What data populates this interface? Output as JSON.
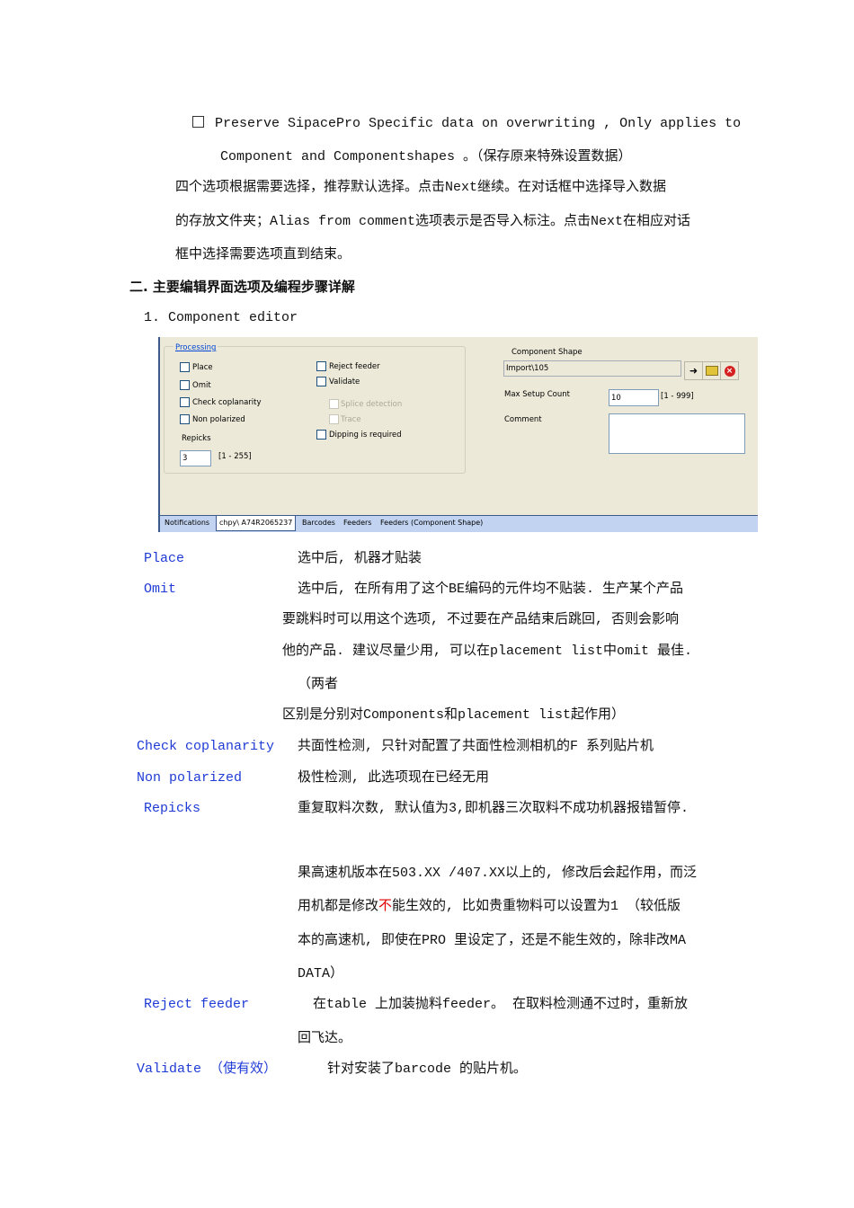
{
  "intro": {
    "checkbox_line1": "Preserve SipacePro Specific data on overwriting , Only applies to",
    "checkbox_line2": "Component and Componentshapes 。（保存原来特殊设置数据）",
    "para_lines": [
      "四个选项根据需要选择，推荐默认选择。点击Next继续。在对话框中选择导入数据",
      "的存放文件夹；Alias from comment选项表示是否导入标注。点击Next在相应对话",
      "框中选择需要选项直到结束。"
    ]
  },
  "section_heading": "二. 主要编辑界面选项及编程步骤详解",
  "subheading": "1. Component editor",
  "screenshot": {
    "group_title": "Processing",
    "left_checks": [
      "Place",
      "Omit",
      "Check coplanarity",
      "Non polarized"
    ],
    "repicks_label": "Repicks",
    "repicks_value": "3",
    "repicks_range": "[1 - 255]",
    "right_checks": [
      "Reject feeder",
      "Validate"
    ],
    "disabled_checks": [
      "Splice detection",
      "Trace"
    ],
    "dipping": "Dipping is required",
    "component_shape_label": "Component Shape",
    "component_shape_value": "Import\\105",
    "max_setup_label": "Max Setup Count",
    "max_setup_value": "10",
    "max_setup_range": "[1 - 999]",
    "comment_label": "Comment",
    "tabs": [
      "Notifications",
      "chpy\\ A74R2065237",
      "Barcodes",
      "Feeders",
      "Feeders (Component Shape)"
    ]
  },
  "defs": {
    "place_term": "Place",
    "place_desc": "选中后, 机器才贴装",
    "omit_term": "Omit",
    "omit_lines": [
      "选中后, 在所有用了这个BE编码的元件均不贴装. 生产某个产品",
      "要跳料时可以用这个选项, 不过要在产品结束后跳回, 否则会影响",
      "他的产品. 建议尽量少用, 可以在placement list中omit  最佳.",
      "（两者",
      "区别是分别对Components和placement list起作用）"
    ],
    "cop_term": "Check coplanarity",
    "cop_desc": "共面性检测, 只针对配置了共面性检测相机的F 系列贴片机",
    "np_term": "Non polarized",
    "np_desc": "极性检测, 此选项现在已经无用",
    "rep_term": "Repicks",
    "rep_desc": "重复取料次数, 默认值为3,即机器三次取料不成功机器报错暂停.",
    "rep_more_1": "果高速机版本在503.XX /407.XX以上的, 修改后会起作用，而泛",
    "rep_more_2a": "用机都是修改",
    "rep_more_2b": "不",
    "rep_more_2c": "能生效的, 比如贵重物料可以设置为1 （较低版",
    "rep_more_3": "本的高速机, 即使在PRO 里设定了，还是不能生效的，除非改MA",
    "rep_more_4": "DATA）",
    "rf_term": "Reject feeder",
    "rf_desc": "在table 上加装抛料feeder。  在取料检测通不过时，重新放",
    "rf_more": "回飞达。",
    "val_term": "Validate （使有效）",
    "val_desc": "针对安装了barcode 的贴片机。"
  }
}
